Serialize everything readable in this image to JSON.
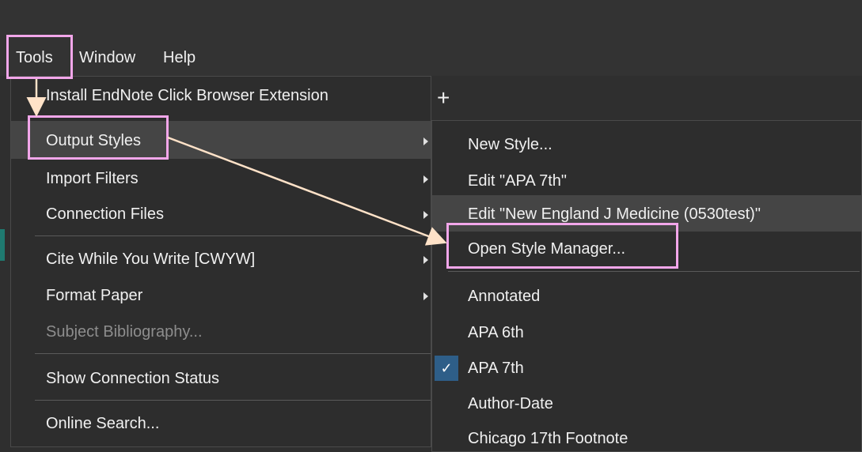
{
  "menubar": {
    "tools": "Tools",
    "window": "Window",
    "help": "Help"
  },
  "tools_menu": {
    "items": [
      {
        "label": "Install EndNote Click Browser Extension"
      },
      {
        "label": "Output Styles"
      },
      {
        "label": "Import Filters"
      },
      {
        "label": "Connection Files"
      },
      {
        "label": "Cite While You Write [CWYW]"
      },
      {
        "label": "Format Paper"
      },
      {
        "label": "Subject Bibliography..."
      },
      {
        "label": "Show Connection Status"
      },
      {
        "label": "Online Search..."
      }
    ]
  },
  "output_styles_menu": {
    "items": [
      {
        "label": "New Style..."
      },
      {
        "label": "Edit \"APA 7th\""
      },
      {
        "label": "Edit \"New England J Medicine (0530test)\""
      },
      {
        "label": "Open Style Manager..."
      },
      {
        "label": "Annotated"
      },
      {
        "label": "APA 6th"
      },
      {
        "label": "APA 7th"
      },
      {
        "label": "Author-Date"
      },
      {
        "label": "Chicago 17th Footnote"
      }
    ]
  },
  "tab_bar": {
    "add_tab": "+"
  },
  "icons": {
    "check": "✓"
  },
  "colors": {
    "highlight_box": "#f2a6ea",
    "arrow": "#ffe2c8",
    "active_row": "#454545",
    "check_bg": "#2e5e88"
  }
}
